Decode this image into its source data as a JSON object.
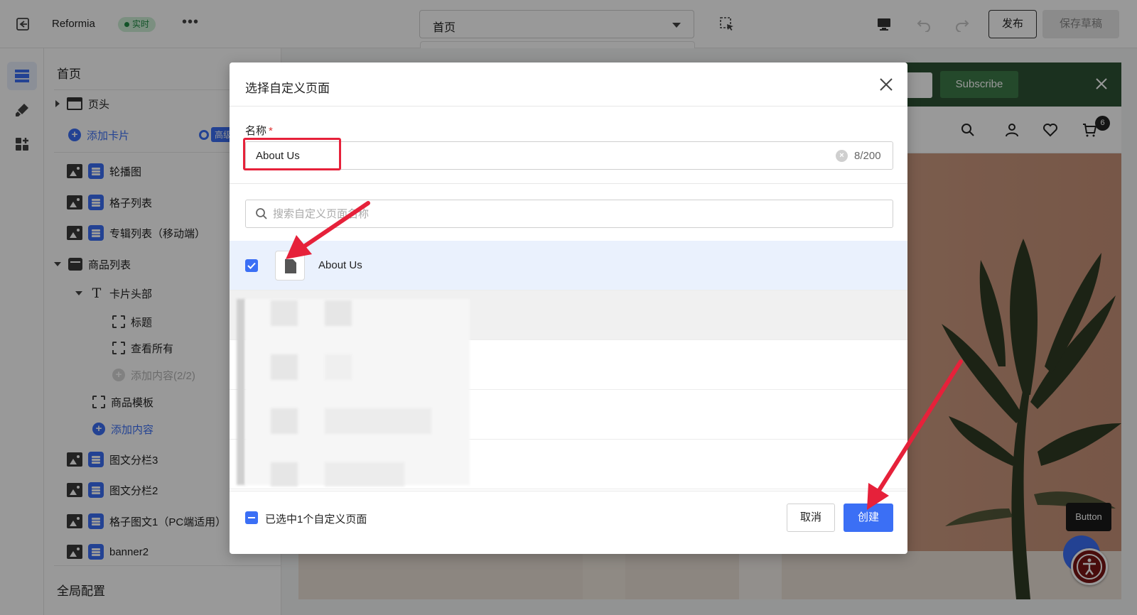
{
  "topbar": {
    "brand": "Reformia",
    "live_badge": "实时",
    "more": "•••",
    "page_select": "首页",
    "publish": "发布",
    "save_draft": "保存草稿"
  },
  "sidebar": {
    "title": "首页",
    "items": [
      {
        "label": "页头"
      },
      {
        "label": "添加卡片"
      },
      {
        "label": "轮播图"
      },
      {
        "label": "格子列表"
      },
      {
        "label": "专辑列表（移动端）"
      },
      {
        "label": "商品列表"
      },
      {
        "label": "卡片头部"
      },
      {
        "label": "标题"
      },
      {
        "label": "查看所有"
      },
      {
        "label": "添加内容(2/2)"
      },
      {
        "label": "商品模板"
      },
      {
        "label": "添加内容"
      },
      {
        "label": "图文分栏3"
      },
      {
        "label": "图文分栏2"
      },
      {
        "label": "格子图文1（PC端适用）"
      },
      {
        "label": "banner2"
      }
    ],
    "advanced_tag": "高级",
    "footer": "全局配置"
  },
  "preview": {
    "subscribe": "Subscribe",
    "cart_count": "6",
    "tooltip": "Button"
  },
  "dialog": {
    "title": "选择自定义页面",
    "name_label": "名称",
    "required_mark": "*",
    "name_value": "About Us",
    "char_count": "8/200",
    "search_placeholder": "搜索自定义页面名称",
    "rows": [
      {
        "name": "About Us",
        "checked": true
      }
    ],
    "footer_text": "已选中1个自定义页面",
    "cancel": "取消",
    "create": "创建"
  },
  "colors": {
    "accent": "#3b6ff5",
    "live_badge_bg": "#cdeed6",
    "annotation_red": "#e6213a",
    "subscribe_green": "#3d7a48"
  }
}
